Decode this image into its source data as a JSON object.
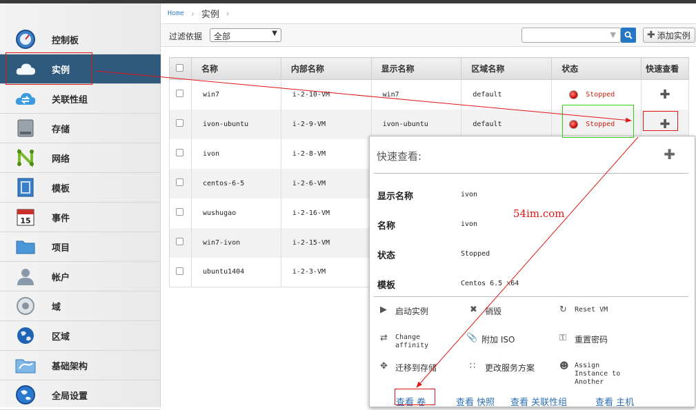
{
  "breadcrumb": {
    "home": "Home",
    "current": "实例"
  },
  "sidebar": {
    "items": [
      {
        "label": "控制板",
        "icon": "dashboard-icon"
      },
      {
        "label": "实例",
        "icon": "cloud-icon"
      },
      {
        "label": "关联性组",
        "icon": "cloud-sync-icon"
      },
      {
        "label": "存储",
        "icon": "storage-icon"
      },
      {
        "label": "网络",
        "icon": "network-icon"
      },
      {
        "label": "模板",
        "icon": "template-icon"
      },
      {
        "label": "事件",
        "icon": "calendar-icon"
      },
      {
        "label": "项目",
        "icon": "folder-icon"
      },
      {
        "label": "帐户",
        "icon": "user-icon"
      },
      {
        "label": "域",
        "icon": "domain-icon"
      },
      {
        "label": "区域",
        "icon": "globe-icon"
      },
      {
        "label": "基础架构",
        "icon": "infrastructure-icon"
      },
      {
        "label": "全局设置",
        "icon": "global-settings-icon"
      }
    ]
  },
  "toolbar": {
    "filter_label": "过滤依据",
    "filter_value": "全部",
    "search_value": "",
    "add_label": "添加实例"
  },
  "table": {
    "headers": [
      "名称",
      "内部名称",
      "显示名称",
      "区域名称",
      "状态",
      "快速查看"
    ],
    "rows": [
      {
        "name": "win7",
        "internal": "i-2-10-VM",
        "display": "win7",
        "zone": "default",
        "status": "Stopped"
      },
      {
        "name": "ivon-ubuntu",
        "internal": "i-2-9-VM",
        "display": "ivon-ubuntu",
        "zone": "default",
        "status": "Stopped"
      },
      {
        "name": "ivon",
        "internal": "i-2-8-VM",
        "display": "",
        "zone": "",
        "status": ""
      },
      {
        "name": "centos-6-5",
        "internal": "i-2-6-VM",
        "display": "",
        "zone": "",
        "status": ""
      },
      {
        "name": "wushugao",
        "internal": "i-2-16-VM",
        "display": "",
        "zone": "",
        "status": ""
      },
      {
        "name": "win7-ivon",
        "internal": "i-2-15-VM",
        "display": "",
        "zone": "",
        "status": ""
      },
      {
        "name": "ubuntu1404",
        "internal": "i-2-3-VM",
        "display": "",
        "zone": "",
        "status": ""
      }
    ]
  },
  "quickview": {
    "title": "快速查看:",
    "fields": [
      {
        "key": "显示名称",
        "value": "ivon"
      },
      {
        "key": "名称",
        "value": "ivon"
      },
      {
        "key": "状态",
        "value": "Stopped"
      },
      {
        "key": "模板",
        "value": "Centos 6.5 x64"
      }
    ],
    "actions": {
      "start": "启动实例",
      "destroy": "销毁",
      "reset": "Reset VM",
      "change_affinity_1": "Change",
      "change_affinity_2": "affinity",
      "attach_iso": "附加 ISO",
      "reset_password": "重置密码",
      "migrate": "迁移到存储",
      "change_offering": "更改服务方案",
      "assign_1": "Assign",
      "assign_2": "Instance to",
      "assign_3": "Another"
    },
    "links": {
      "volumes": "查看 卷",
      "snapshots": "查看 快照",
      "affinity": "查看 关联性组",
      "hosts": "查看 主机"
    }
  },
  "watermark": "54im.com",
  "colors": {
    "sidebar_active": "#2f5a7e",
    "status_stopped": "#c8210d",
    "annotation_red": "#e01515",
    "annotation_green": "#2ecc0f"
  }
}
